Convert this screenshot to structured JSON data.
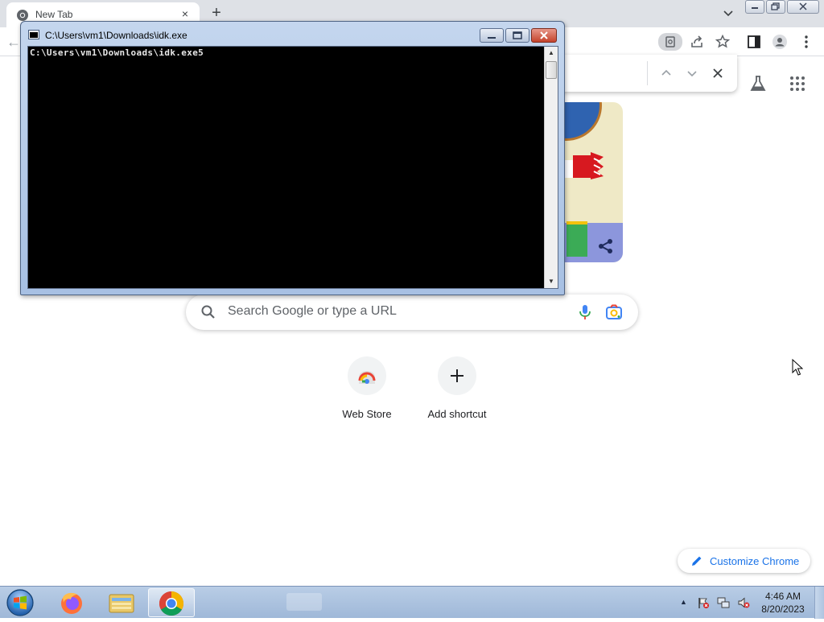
{
  "browser": {
    "tab_title": "New Tab",
    "tab_close_glyph": "×",
    "new_tab_glyph": "+",
    "back_glyph": "←"
  },
  "search": {
    "placeholder": "Search Google or type a URL"
  },
  "shortcuts": [
    {
      "label": "Web Store",
      "icon": "web-store-icon"
    },
    {
      "label": "Add shortcut",
      "icon": "plus-icon"
    }
  ],
  "customize": {
    "label": "Customize Chrome"
  },
  "console": {
    "title": "C:\\Users\\vm1\\Downloads\\idk.exe",
    "output": "C:\\Users\\vm1\\Downloads\\idk.exe5"
  },
  "taskbar": {
    "items": [
      "start-orb",
      "firefox-icon",
      "file-explorer-icon",
      "chrome-icon"
    ],
    "time": "4:46 AM",
    "date": "8/20/2023"
  },
  "colors": {
    "accent": "#1a73e8",
    "console_bg": "#000000",
    "taskbar": "#b9cde6"
  }
}
